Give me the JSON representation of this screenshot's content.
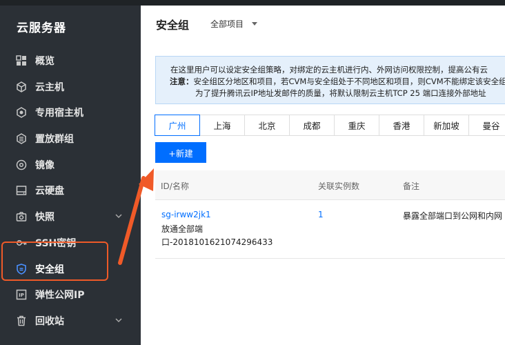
{
  "sidebar": {
    "title": "云服务器",
    "items": [
      {
        "label": "概览",
        "icon": "grid-icon"
      },
      {
        "label": "云主机",
        "icon": "cube-icon"
      },
      {
        "label": "专用宿主机",
        "icon": "host-icon"
      },
      {
        "label": "置放群组",
        "icon": "group-icon"
      },
      {
        "label": "镜像",
        "icon": "disc-icon"
      },
      {
        "label": "云硬盘",
        "icon": "disk-icon"
      },
      {
        "label": "快照",
        "icon": "camera-icon"
      },
      {
        "label": "SSH密钥",
        "icon": "key-icon"
      },
      {
        "label": "安全组",
        "icon": "shield-icon"
      },
      {
        "label": "弹性公网IP",
        "icon": "ip-icon"
      },
      {
        "label": "回收站",
        "icon": "trash-icon"
      }
    ]
  },
  "header": {
    "title": "安全组",
    "project": "全部项目"
  },
  "notice": {
    "line1": "在这里用户可以设定安全组策略，对绑定的云主机进行内、外网访问权限控制，提高公有云",
    "label": "注意：",
    "line2": "安全组区分地区和项目，若CVM与安全组处于不同地区和项目，则CVM不能绑定该安全组",
    "line3": "为了提升腾讯云IP地址发邮件的质量，将默认限制云主机TCP 25 端口连接外部地址"
  },
  "regions": [
    "广州",
    "上海",
    "北京",
    "成都",
    "重庆",
    "香港",
    "新加坡",
    "曼谷"
  ],
  "new_button": "+新建",
  "table": {
    "columns": [
      "ID/名称",
      "关联实例数",
      "备注"
    ],
    "rows": [
      {
        "id": "sg-irww2jk1",
        "name_line1": "放通全部端",
        "name_line2": "口-2018101621074296433",
        "instances": "1",
        "remark": "暴露全部端口到公网和内网"
      }
    ]
  },
  "colors": {
    "accent": "#006eff",
    "sidebar_bg": "#2b3036",
    "highlight": "#f05a28"
  }
}
